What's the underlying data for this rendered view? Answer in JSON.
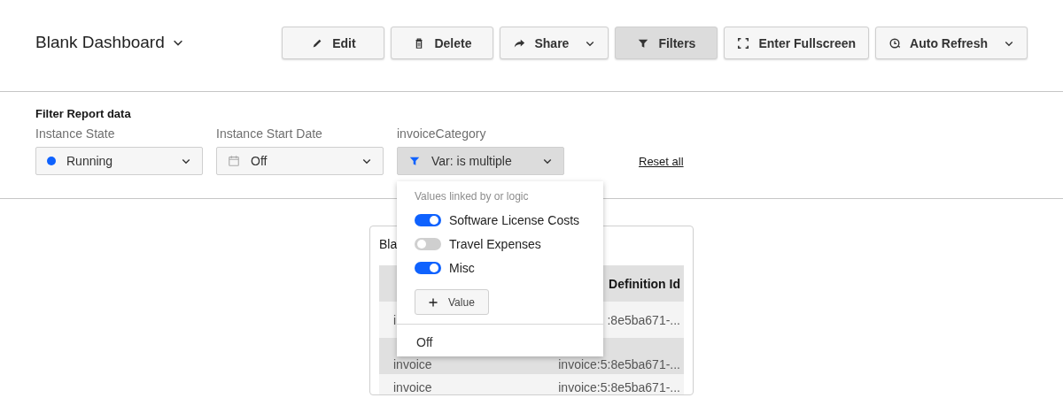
{
  "header": {
    "title": "Blank Dashboard",
    "buttons": [
      {
        "label": "Edit",
        "kind": "pencil",
        "dropdown": false,
        "selected": false
      },
      {
        "label": "Delete",
        "kind": "trash",
        "dropdown": false,
        "selected": false
      },
      {
        "label": "Share",
        "kind": "share",
        "dropdown": true,
        "selected": false
      },
      {
        "label": "Filters",
        "kind": "filter",
        "dropdown": false,
        "selected": true
      },
      {
        "label": "Enter Fullscreen",
        "kind": "fullscreen",
        "dropdown": false,
        "selected": false
      },
      {
        "label": "Auto Refresh",
        "kind": "clock",
        "dropdown": true,
        "selected": false
      }
    ]
  },
  "filters": {
    "title": "Filter Report data",
    "fields": [
      {
        "label": "Instance State",
        "value": "Running",
        "kind": "dot",
        "color": "#0f62fe",
        "open": false
      },
      {
        "label": "Instance Start Date",
        "value": "Off",
        "kind": "calendar",
        "open": false
      },
      {
        "label": "invoiceCategory",
        "value": "Var: is multiple",
        "kind": "filter",
        "open": true
      }
    ],
    "reset_link": "Reset all"
  },
  "popup": {
    "hint": "Values linked by or logic",
    "options": [
      {
        "label": "Software License Costs",
        "on": true
      },
      {
        "label": "Travel Expenses",
        "on": false
      },
      {
        "label": "Misc",
        "on": true
      }
    ],
    "add_button": "Value",
    "off_option": "Off"
  },
  "card": {
    "title": "Bla",
    "columns": [
      "",
      "Definition Id"
    ],
    "rows": [
      [
        "i",
        ":8e5ba671-..."
      ],
      [
        "invoice",
        "invoice:5:8e5ba671-..."
      ],
      [
        "invoice",
        "invoice:5:8e5ba671-..."
      ]
    ]
  }
}
